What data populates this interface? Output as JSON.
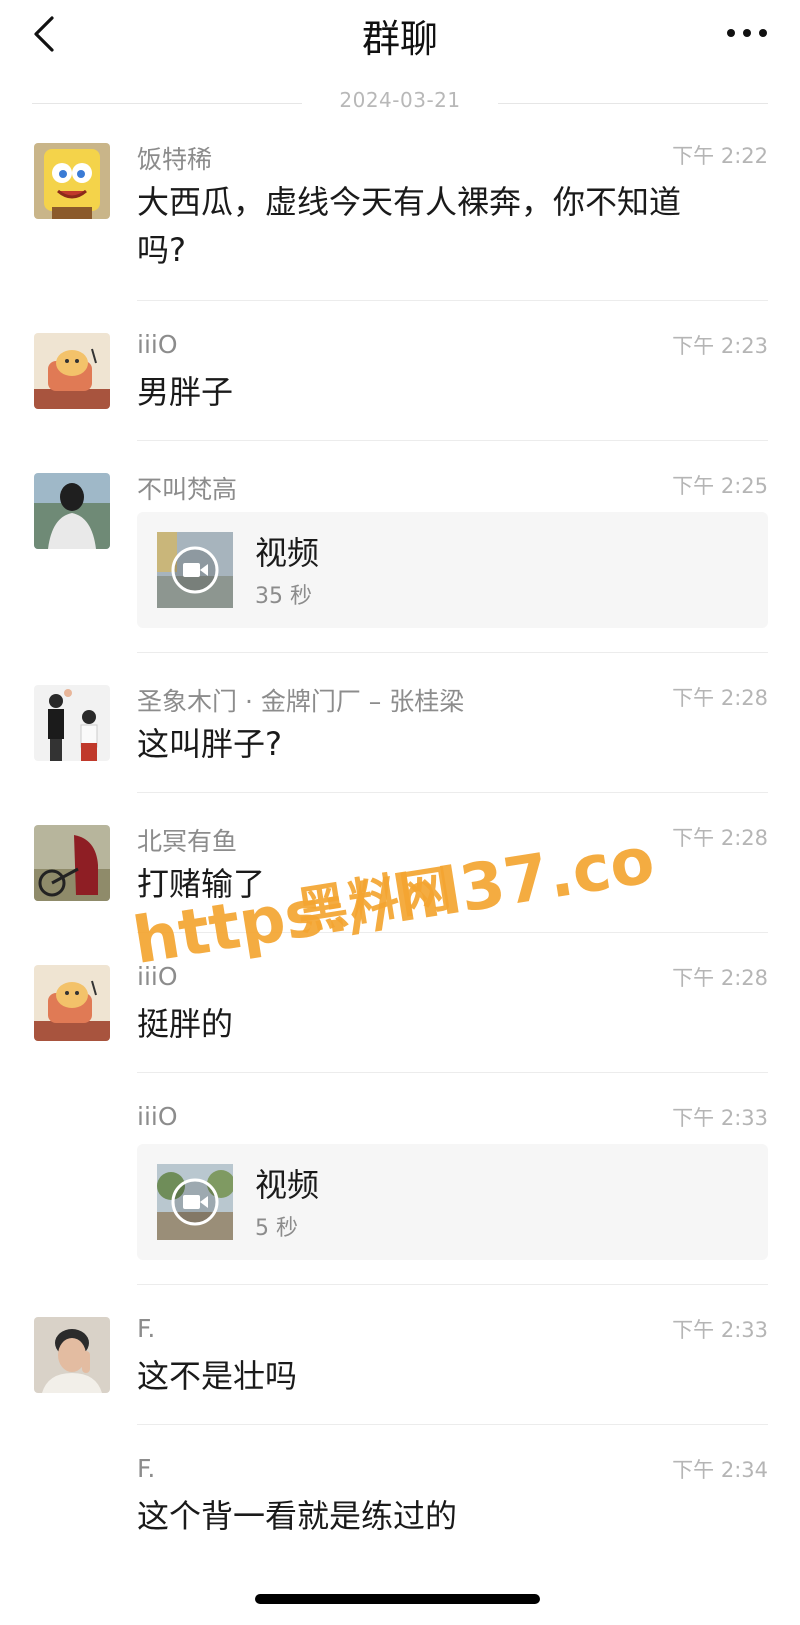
{
  "header": {
    "title": "群聊",
    "back_icon": "chevron-left-icon",
    "more_icon": "more-dots-icon"
  },
  "date_separator": "2024-03-21",
  "messages": [
    {
      "sender": "饭特稀",
      "time": "下午 2:22",
      "text": "大西瓜，虚线今天有人裸奔，你不知道吗?",
      "avatar": "spongebob-avatar"
    },
    {
      "sender": "iiiO",
      "time": "下午 2:23",
      "text": "男胖子",
      "avatar": "cartoon-dog-avatar"
    },
    {
      "sender": "不叫梵高",
      "time": "下午 2:25",
      "video": {
        "title": "视频",
        "duration": "35 秒"
      },
      "avatar": "person-back-avatar"
    },
    {
      "sender": "圣象木门 · 金牌门厂 – 张桂梁",
      "time": "下午 2:28",
      "text": "这叫胖子?",
      "avatar": "family-avatar"
    },
    {
      "sender": "北冥有鱼",
      "time": "下午 2:28",
      "text": "打赌输了",
      "avatar": "bicycle-avatar"
    },
    {
      "sender": "iiiO",
      "time": "下午 2:28",
      "text": "挺胖的",
      "avatar": "cartoon-dog-avatar"
    },
    {
      "sender": "iiiO",
      "time": "下午 2:33",
      "video": {
        "title": "视频",
        "duration": "5 秒"
      }
    },
    {
      "sender": "F.",
      "time": "下午 2:33",
      "text": "这不是壮吗",
      "avatar": "man-portrait-avatar"
    },
    {
      "sender": "F.",
      "time": "下午 2:34",
      "text": "这个背一看就是练过的"
    }
  ],
  "watermark": {
    "cn": "黑料网",
    "url": "https://hl37.co",
    "color": "#f4a531"
  }
}
